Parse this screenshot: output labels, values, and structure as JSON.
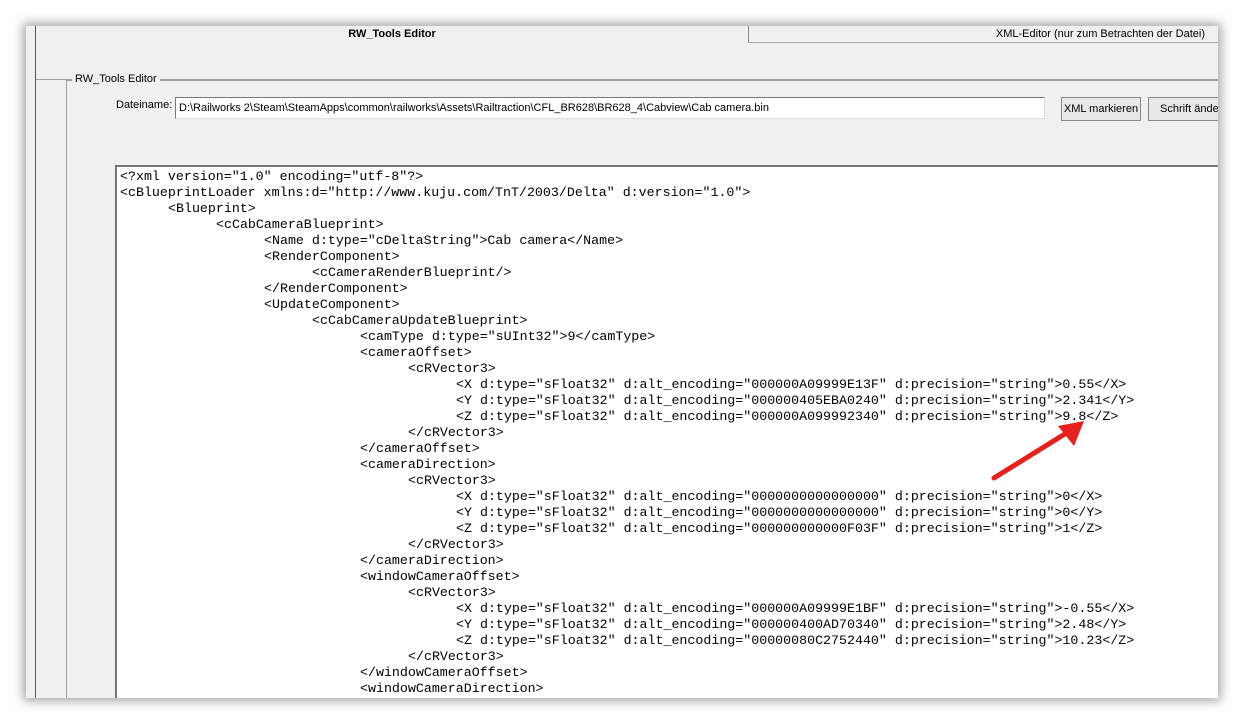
{
  "tabs": [
    {
      "label": "RW_Tools Editor",
      "active": true
    },
    {
      "label": "XML-Editor (nur zum Betrachten der Datei)",
      "active": false
    }
  ],
  "group_label": "RW_Tools Editor",
  "filename_label": "Dateiname:",
  "filename_value": "D:\\Railworks 2\\Steam\\SteamApps\\common\\railworks\\Assets\\Railtraction\\CFL_BR628\\BR628_4\\Cabview\\Cab camera.bin",
  "buttons": {
    "mark_xml": "XML markieren",
    "change_font": "Schrift ände"
  },
  "annotation_arrow_color": "#e8201c",
  "xml_lines": [
    {
      "indent": 0,
      "text": "<?xml version=\"1.0\" encoding=\"utf-8\"?>"
    },
    {
      "indent": 0,
      "text": "<cBlueprintLoader xmlns:d=\"http://www.kuju.com/TnT/2003/Delta\" d:version=\"1.0\">"
    },
    {
      "indent": 1,
      "text": "<Blueprint>"
    },
    {
      "indent": 2,
      "text": "<cCabCameraBlueprint>"
    },
    {
      "indent": 3,
      "text": "<Name d:type=\"cDeltaString\">Cab camera</Name>"
    },
    {
      "indent": 3,
      "text": "<RenderComponent>"
    },
    {
      "indent": 4,
      "text": "<cCameraRenderBlueprint/>"
    },
    {
      "indent": 3,
      "text": "</RenderComponent>"
    },
    {
      "indent": 3,
      "text": "<UpdateComponent>"
    },
    {
      "indent": 4,
      "text": "<cCabCameraUpdateBlueprint>"
    },
    {
      "indent": 5,
      "text": "<camType d:type=\"sUInt32\">9</camType>"
    },
    {
      "indent": 5,
      "text": "<cameraOffset>"
    },
    {
      "indent": 6,
      "text": "<cRVector3>"
    },
    {
      "indent": 7,
      "text": "<X d:type=\"sFloat32\" d:alt_encoding=\"000000A09999E13F\" d:precision=\"string\">0.55</X>"
    },
    {
      "indent": 7,
      "text": "<Y d:type=\"sFloat32\" d:alt_encoding=\"000000405EBA0240\" d:precision=\"string\">2.341</Y>"
    },
    {
      "indent": 7,
      "text": "<Z d:type=\"sFloat32\" d:alt_encoding=\"000000A099992340\" d:precision=\"string\">9.8</Z>"
    },
    {
      "indent": 6,
      "text": "</cRVector3>"
    },
    {
      "indent": 5,
      "text": "</cameraOffset>"
    },
    {
      "indent": 5,
      "text": "<cameraDirection>"
    },
    {
      "indent": 6,
      "text": "<cRVector3>"
    },
    {
      "indent": 7,
      "text": "<X d:type=\"sFloat32\" d:alt_encoding=\"0000000000000000\" d:precision=\"string\">0</X>"
    },
    {
      "indent": 7,
      "text": "<Y d:type=\"sFloat32\" d:alt_encoding=\"0000000000000000\" d:precision=\"string\">0</Y>"
    },
    {
      "indent": 7,
      "text": "<Z d:type=\"sFloat32\" d:alt_encoding=\"000000000000F03F\" d:precision=\"string\">1</Z>"
    },
    {
      "indent": 6,
      "text": "</cRVector3>"
    },
    {
      "indent": 5,
      "text": "</cameraDirection>"
    },
    {
      "indent": 5,
      "text": "<windowCameraOffset>"
    },
    {
      "indent": 6,
      "text": "<cRVector3>"
    },
    {
      "indent": 7,
      "text": "<X d:type=\"sFloat32\" d:alt_encoding=\"000000A09999E1BF\" d:precision=\"string\">-0.55</X>"
    },
    {
      "indent": 7,
      "text": "<Y d:type=\"sFloat32\" d:alt_encoding=\"000000400AD70340\" d:precision=\"string\">2.48</Y>"
    },
    {
      "indent": 7,
      "text": "<Z d:type=\"sFloat32\" d:alt_encoding=\"00000080C2752440\" d:precision=\"string\">10.23</Z>"
    },
    {
      "indent": 6,
      "text": "</cRVector3>"
    },
    {
      "indent": 5,
      "text": "</windowCameraOffset>"
    },
    {
      "indent": 5,
      "text": "<windowCameraDirection>"
    }
  ]
}
